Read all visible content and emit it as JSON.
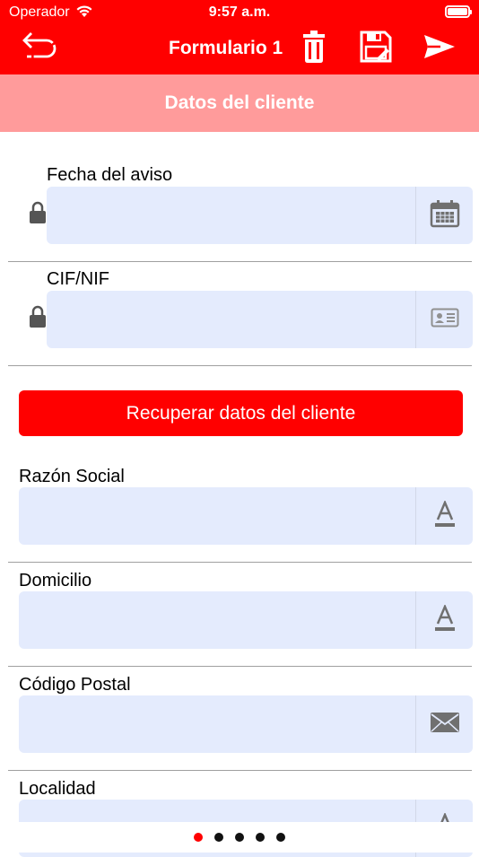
{
  "status_bar": {
    "carrier": "Operador",
    "time": "9:57 a.m."
  },
  "navbar": {
    "title": "Formulario 1",
    "icons": [
      "back-icon",
      "trash-icon",
      "save-icon",
      "send-icon"
    ]
  },
  "section": {
    "title": "Datos del cliente"
  },
  "fields": {
    "fecha": {
      "label": "Fecha del aviso",
      "value": "",
      "icon": "calendar-icon"
    },
    "cif": {
      "label": "CIF/NIF",
      "value": "",
      "icon": "id-card-icon"
    },
    "razon": {
      "label": "Razón Social",
      "value": "",
      "icon": "text-format-icon"
    },
    "domicilio": {
      "label": "Domicilio",
      "value": "",
      "icon": "text-format-icon"
    },
    "cp": {
      "label": "Código Postal",
      "value": "",
      "icon": "envelope-icon"
    },
    "localidad": {
      "label": "Localidad",
      "value": "",
      "icon": "text-format-icon"
    }
  },
  "action_button": {
    "label": "Recuperar datos del cliente"
  },
  "pager": {
    "pages": 5,
    "current": 1
  },
  "colors": {
    "accent": "#ff0000",
    "header": "#ff9b9b",
    "input_bg": "#e4ebfd"
  }
}
